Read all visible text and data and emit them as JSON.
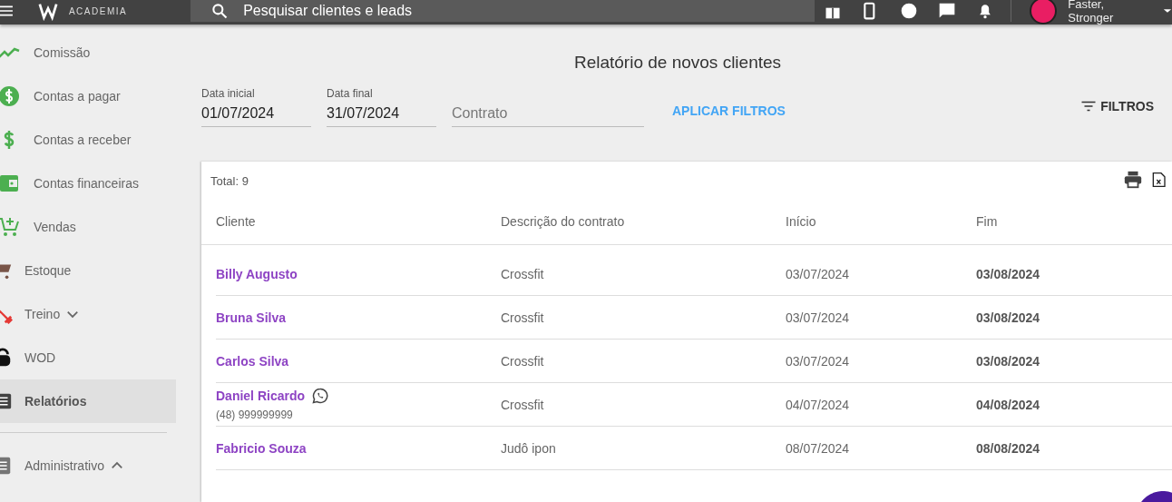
{
  "top_bar": {
    "logo_text": "ACADEMIA",
    "search": {
      "placeholder": "Pesquisar clientes e leads"
    },
    "user_name": "Faster, Stronger"
  },
  "sidebar": {
    "items": [
      {
        "label": "Comissão",
        "selected": false
      },
      {
        "label": "Contas a pagar",
        "selected": false
      },
      {
        "label": "Contas a receber",
        "selected": false
      },
      {
        "label": "Contas financeiras",
        "selected": false
      },
      {
        "label": "Vendas",
        "selected": false
      },
      {
        "label": "Estoque",
        "selected": false
      },
      {
        "label": "Treino",
        "selected": false,
        "expanded": false
      },
      {
        "label": "WOD",
        "selected": false
      },
      {
        "label": "Relatórios",
        "selected": true
      },
      {
        "label": "Administrativo",
        "selected": false,
        "expanded": true,
        "divider_before": true
      }
    ]
  },
  "report": {
    "title": "Relatório de novos clientes",
    "filters": [
      {
        "label": "Data inicial",
        "value": "01/07/2024"
      },
      {
        "label": "Data final",
        "value": "31/07/2024"
      },
      {
        "placeholder": "Contrato"
      }
    ],
    "apply_button": "APLICAR FILTROS",
    "filters_button": "FILTROS",
    "total": "Total: 9",
    "table": {
      "columns": [
        "Cliente",
        "Descrição do contrato",
        "Início",
        "Fim"
      ],
      "rows": [
        {
          "client": "Billy Augusto",
          "whatsapp": false,
          "contract": "Crossfit",
          "start": "03/07/2024",
          "end": "03/08/2024"
        },
        {
          "client": "Bruna Silva",
          "whatsapp": false,
          "contract": "Crossfit",
          "start": "03/07/2024",
          "end": "03/08/2024"
        },
        {
          "client": "Carlos Silva",
          "whatsapp": false,
          "contract": "Crossfit",
          "start": "03/07/2024",
          "end": "03/08/2024"
        },
        {
          "client": "Daniel Ricardo",
          "whatsapp": true,
          "phone": "(48) 999999999",
          "contract": "Crossfit",
          "start": "04/07/2024",
          "end": "04/08/2024"
        },
        {
          "client": "Fabricio Souza",
          "whatsapp": false,
          "contract": "Judô ipon",
          "start": "08/07/2024",
          "end": "08/08/2024"
        }
      ]
    }
  }
}
